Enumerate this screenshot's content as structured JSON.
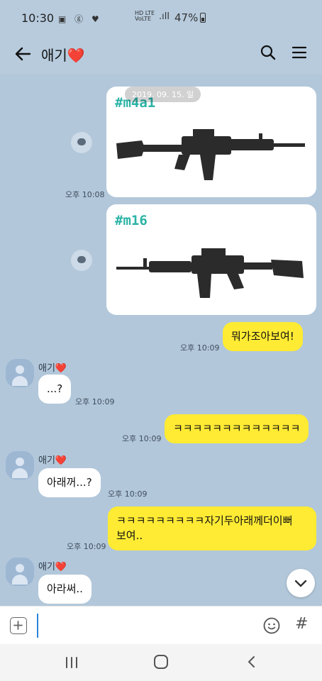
{
  "status": {
    "time": "10:30",
    "notif_icons": "▣ ⓖ ♥",
    "net": "HD LTE",
    "net_sub": "VoLTE",
    "battery": "47%"
  },
  "header": {
    "title": "애기❤️"
  },
  "chat": {
    "date": "2019. 09. 15. 일",
    "cards": [
      {
        "tag": "#m4a1",
        "time": "오후 10:08",
        "image_label": "M4A1 rifle image"
      },
      {
        "tag": "#m16",
        "time": "",
        "image_label": "M16 rifle image"
      }
    ],
    "messages": [
      {
        "from": "me",
        "text": "뭐가조아보여!",
        "time": "오후 10:09"
      },
      {
        "from": "you",
        "sender": "애기❤️",
        "text": "...?",
        "time": "오후 10:09"
      },
      {
        "from": "me",
        "text": "ㅋㅋㅋㅋㅋㅋㅋㅋㅋㅋㅋㅋㅋ",
        "time": "오후 10:09"
      },
      {
        "from": "you",
        "sender": "애기❤️",
        "text": "아래꺼...?",
        "time": "오후 10:09"
      },
      {
        "from": "me",
        "text": "ㅋㅋㅋㅋㅋㅋㅋㅋㅋ자기두아래께더이뻐",
        "text2": "보여..",
        "time": "오후 10:09"
      },
      {
        "from": "you",
        "sender": "애기❤️",
        "text": "아라써..",
        "time": ""
      }
    ]
  },
  "input": {
    "value": "",
    "placeholder": ""
  },
  "colors": {
    "background": "#b2c7da",
    "my_bubble": "#ffeb33",
    "their_bubble": "#ffffff",
    "tag": "#2bb3a6"
  }
}
